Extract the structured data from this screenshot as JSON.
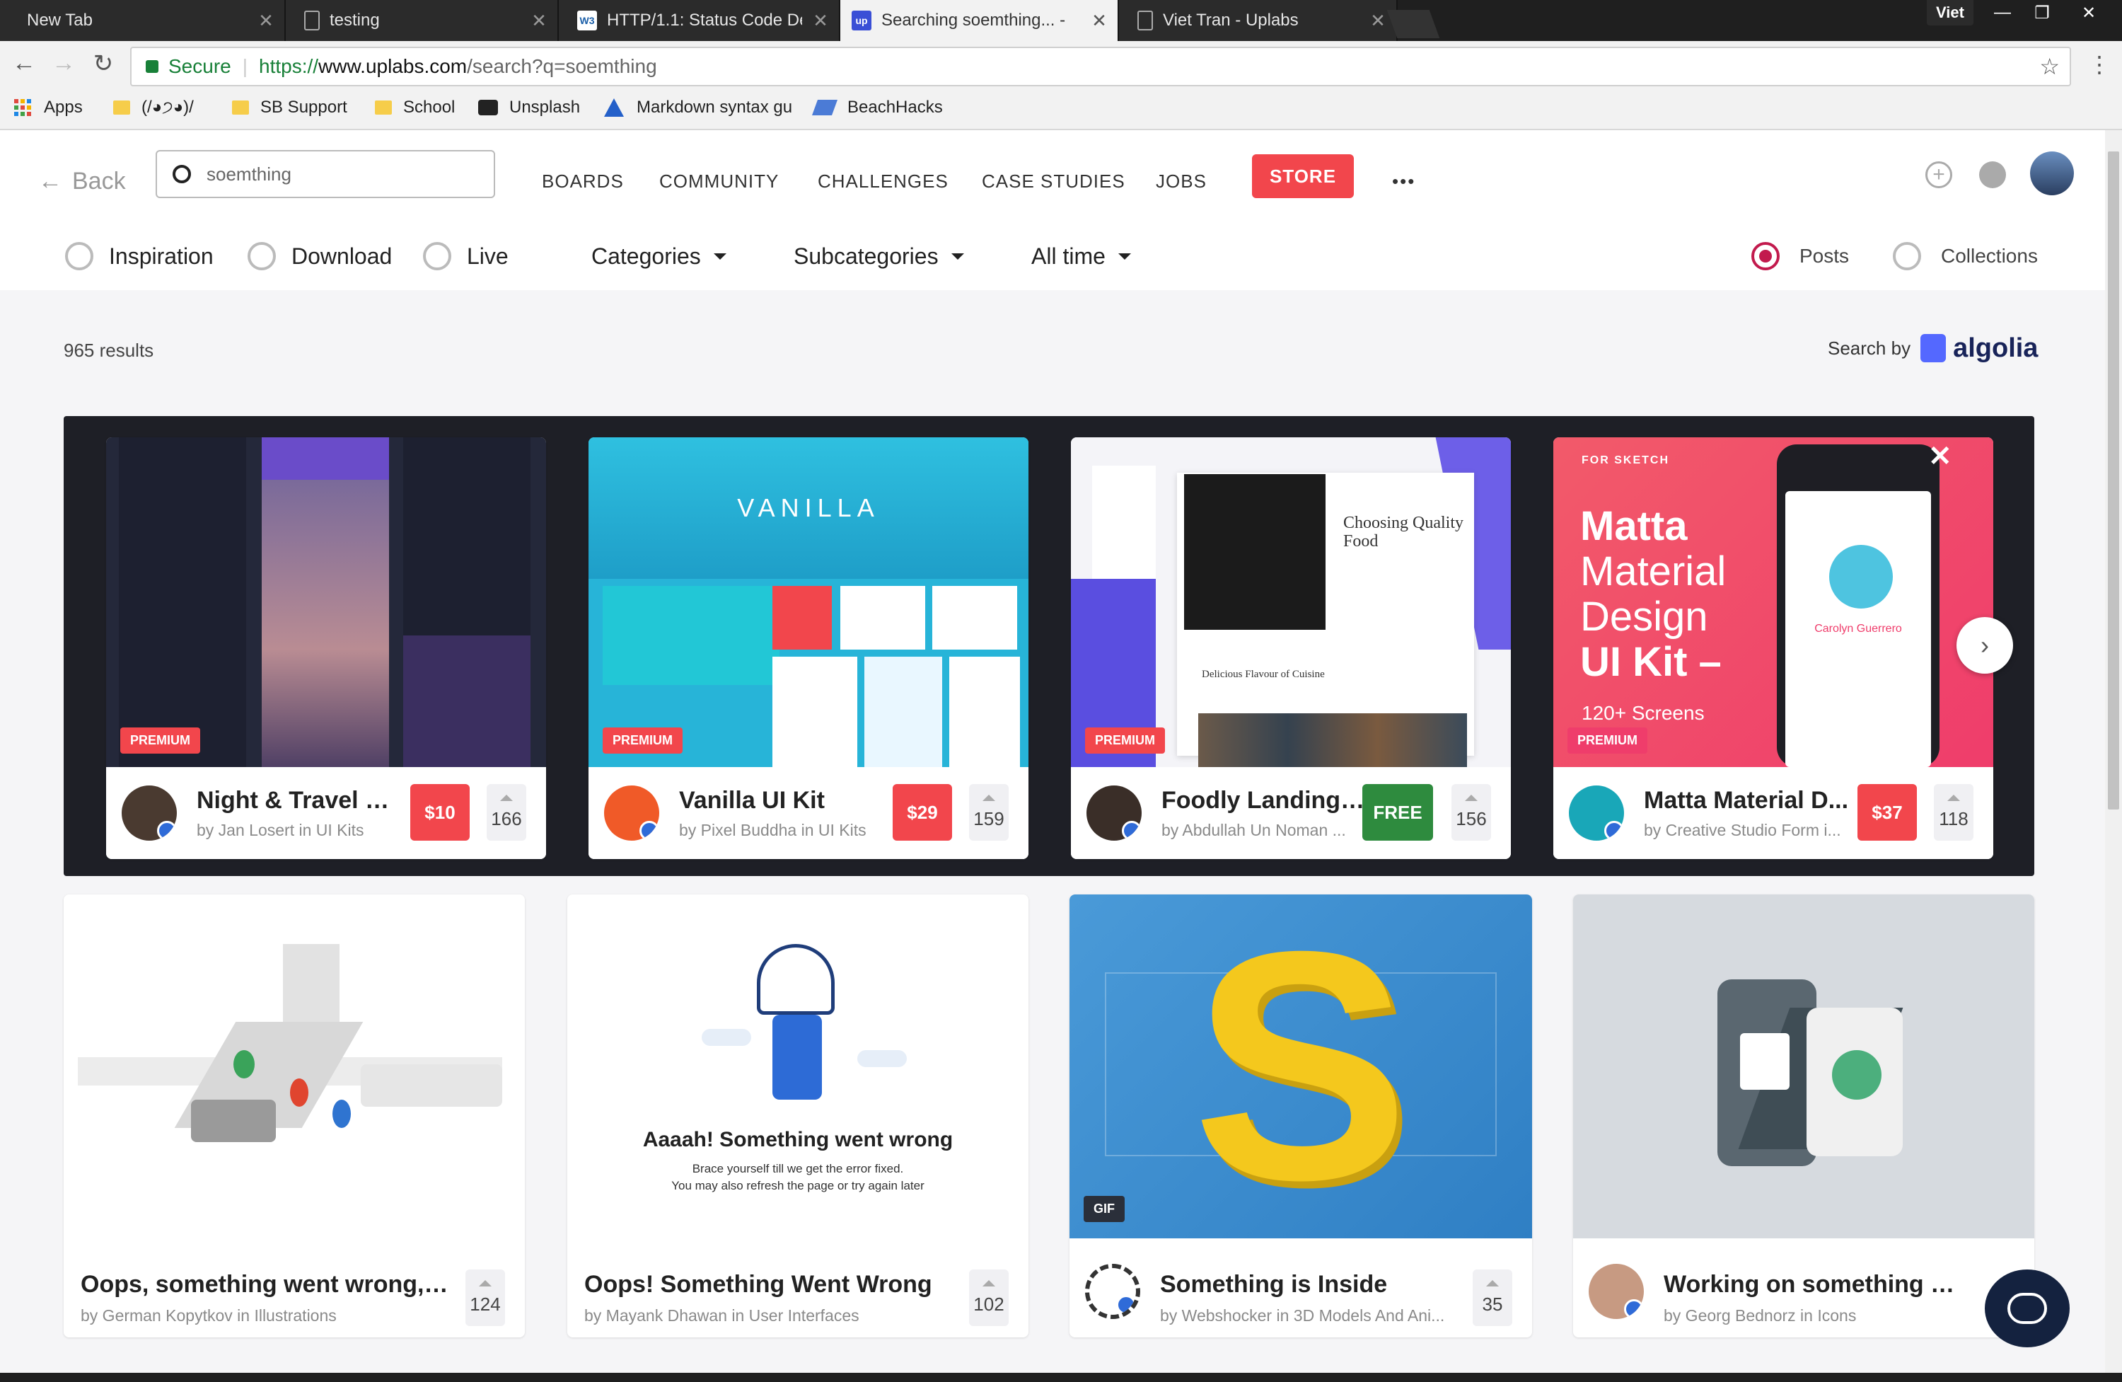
{
  "browser": {
    "tabs": [
      {
        "title": "New Tab",
        "favicon": "blank"
      },
      {
        "title": "testing",
        "favicon": "document"
      },
      {
        "title": "HTTP/1.1: Status Code De",
        "favicon": "w3c"
      },
      {
        "title": "Searching soemthing... -",
        "favicon": "uplabs"
      },
      {
        "title": "Viet Tran - Uplabs",
        "favicon": "document"
      }
    ],
    "profile_name": "Viet",
    "secure_label": "Secure",
    "url_scheme": "https://",
    "url_host": "www.uplabs.com",
    "url_path": "/search?q=soemthing",
    "bookmarks": [
      {
        "label": "Apps",
        "icon": "apps-grid-icon"
      },
      {
        "label": "(/◕੭◕)/",
        "icon": "folder-icon"
      },
      {
        "label": "SB Support",
        "icon": "folder-icon"
      },
      {
        "label": "School",
        "icon": "folder-icon"
      },
      {
        "label": "Unsplash",
        "icon": "camera-icon"
      },
      {
        "label": "Markdown syntax gu",
        "icon": "atlassian-icon"
      },
      {
        "label": "BeachHacks",
        "icon": "devpost-icon"
      }
    ]
  },
  "header": {
    "back_label": "Back",
    "search_value": "soemthing",
    "nav": [
      "BOARDS",
      "COMMUNITY",
      "CHALLENGES",
      "CASE STUDIES",
      "JOBS"
    ],
    "store_label": "STORE",
    "more_label": "•••"
  },
  "filters": {
    "types": [
      "Inspiration",
      "Download",
      "Live"
    ],
    "dropdowns": [
      "Categories",
      "Subcategories",
      "All time"
    ],
    "views": [
      {
        "label": "Posts",
        "selected": true
      },
      {
        "label": "Collections",
        "selected": false
      }
    ]
  },
  "results": {
    "count": "965 results",
    "search_by": "Search by",
    "provider": "algolia"
  },
  "featured": [
    {
      "title": "Night & Travel UI ...",
      "by": "by Jan Losert in UI Kits",
      "price": "$10",
      "votes": "166",
      "badge": "PREMIUM",
      "price_color": "#f2464c"
    },
    {
      "title": "Vanilla UI Kit",
      "by": "by Pixel Buddha in UI Kits",
      "price": "$29",
      "votes": "159",
      "badge": "PREMIUM",
      "price_color": "#f2464c",
      "thumb_text": "VANILLA"
    },
    {
      "title": "Foodly Landing ...",
      "by": "by Abdullah Un Noman ...",
      "price": "FREE",
      "votes": "156",
      "badge": "PREMIUM",
      "price_color": "#2e8b3e",
      "thumb_heading": "Choosing Quality Food",
      "thumb_sub": "Delicious Flavour of Cuisine"
    },
    {
      "title": "Matta Material D...",
      "by": "by Creative Studio Form i...",
      "price": "$37",
      "votes": "118",
      "badge": "PREMIUM",
      "price_color": "#f2464c",
      "thumb_kicker": "FOR SKETCH",
      "thumb_lines": [
        "Matta",
        "Material",
        "Design",
        "UI Kit –"
      ],
      "thumb_count": "120+ Screens",
      "thumb_name": "Carolyn Guerrero"
    }
  ],
  "posts": [
    {
      "title": "Oops, something went wrong, Goo...",
      "by": "by German Kopytkov in Illustrations",
      "votes": "124"
    },
    {
      "title": "Oops! Something Went Wrong",
      "by": "by Mayank Dhawan in User Interfaces",
      "votes": "102",
      "thumb_heading": "Aaaah! Something went wrong",
      "thumb_line1": "Brace yourself till we get the error fixed.",
      "thumb_line2": "You may also refresh the page or try again later"
    },
    {
      "title": "Something is Inside",
      "by": "by Webshocker in 3D Models And Ani...",
      "votes": "35",
      "badge": "GIF",
      "thumb_letter": "S"
    },
    {
      "title": "Working on something new",
      "by": "by Georg Bednorz in Icons",
      "votes": ""
    }
  ],
  "colors": {
    "accent": "#f2464c",
    "radio_on": "#c21a4d",
    "algolia": "#5468ff",
    "free": "#2e8b3e",
    "chat": "#14223f"
  }
}
